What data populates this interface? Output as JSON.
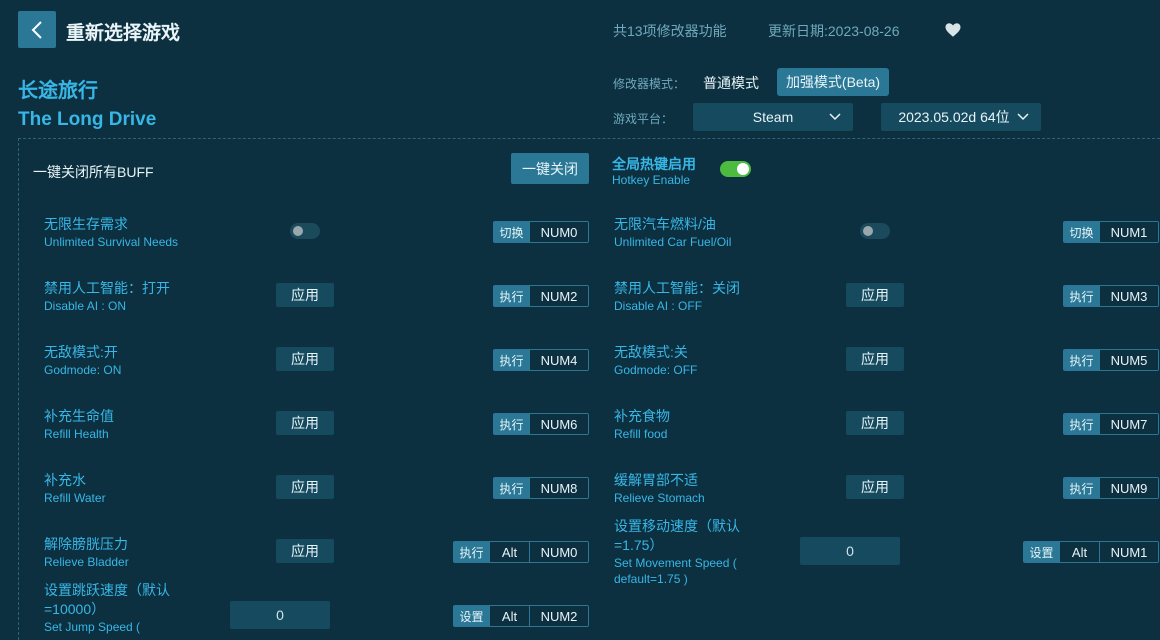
{
  "header": {
    "title": "重新选择游戏",
    "feature_count": "共13项修改器功能",
    "update_date": "更新日期:2023-08-26"
  },
  "game": {
    "name_cn": "长途旅行",
    "name_en": "The Long Drive"
  },
  "mode": {
    "label": "修改器模式：",
    "normal": "普通模式",
    "beta": "加强模式(Beta)",
    "selected": "beta"
  },
  "platform": {
    "label": "游戏平台：",
    "selected": "Steam",
    "version": "2023.05.02d 64位"
  },
  "master": {
    "label": "一键关闭所有BUFF",
    "button": "一键关闭"
  },
  "hotkey_enable": {
    "label_cn": "全局热键启用",
    "label_en": "Hotkey Enable",
    "on": true
  },
  "features": [
    {
      "cn": "无限生存需求",
      "en": "Unlimited Survival Needs",
      "control": "toggle",
      "action": "切换",
      "keys": [
        "NUM0"
      ]
    },
    {
      "cn": "无限汽车燃料/油",
      "en": "Unlimited Car Fuel/Oil",
      "control": "toggle",
      "action": "切换",
      "keys": [
        "NUM1"
      ]
    },
    {
      "cn": "禁用人工智能：打开",
      "en": "Disable AI : ON",
      "control": "应用",
      "action": "执行",
      "keys": [
        "NUM2"
      ]
    },
    {
      "cn": "禁用人工智能：关闭",
      "en": "Disable AI : OFF",
      "control": "应用",
      "action": "执行",
      "keys": [
        "NUM3"
      ]
    },
    {
      "cn": "无敌模式:开",
      "en": "Godmode: ON",
      "control": "应用",
      "action": "执行",
      "keys": [
        "NUM4"
      ]
    },
    {
      "cn": "无敌模式:关",
      "en": "Godmode: OFF",
      "control": "应用",
      "action": "执行",
      "keys": [
        "NUM5"
      ]
    },
    {
      "cn": "补充生命值",
      "en": "Refill Health",
      "control": "应用",
      "action": "执行",
      "keys": [
        "NUM6"
      ]
    },
    {
      "cn": "补充食物",
      "en": "Refill food",
      "control": "应用",
      "action": "执行",
      "keys": [
        "NUM7"
      ]
    },
    {
      "cn": "补充水",
      "en": "Refill Water",
      "control": "应用",
      "action": "执行",
      "keys": [
        "NUM8"
      ]
    },
    {
      "cn": "缓解胃部不适",
      "en": "Relieve Stomach",
      "control": "应用",
      "action": "执行",
      "keys": [
        "NUM9"
      ]
    },
    {
      "cn": "解除膀胱压力",
      "en": "Relieve Bladder",
      "control": "应用",
      "action": "执行",
      "keys": [
        "Alt",
        "NUM0"
      ]
    },
    {
      "cn": "设置移动速度（默认=1.75）",
      "cn1": "设置移动速度（默认",
      "cn2": "=1.75）",
      "en1": "Set Movement Speed (",
      "en2": "default=1.75 )",
      "control": "input",
      "value": "0",
      "action": "设置",
      "keys": [
        "Alt",
        "NUM1"
      ]
    },
    {
      "cn1": "设置跳跃速度（默认",
      "cn2": "=10000）",
      "en1": "Set Jump Speed (",
      "control": "input",
      "value": "0",
      "action": "设置",
      "keys": [
        "Alt",
        "NUM2"
      ]
    }
  ]
}
